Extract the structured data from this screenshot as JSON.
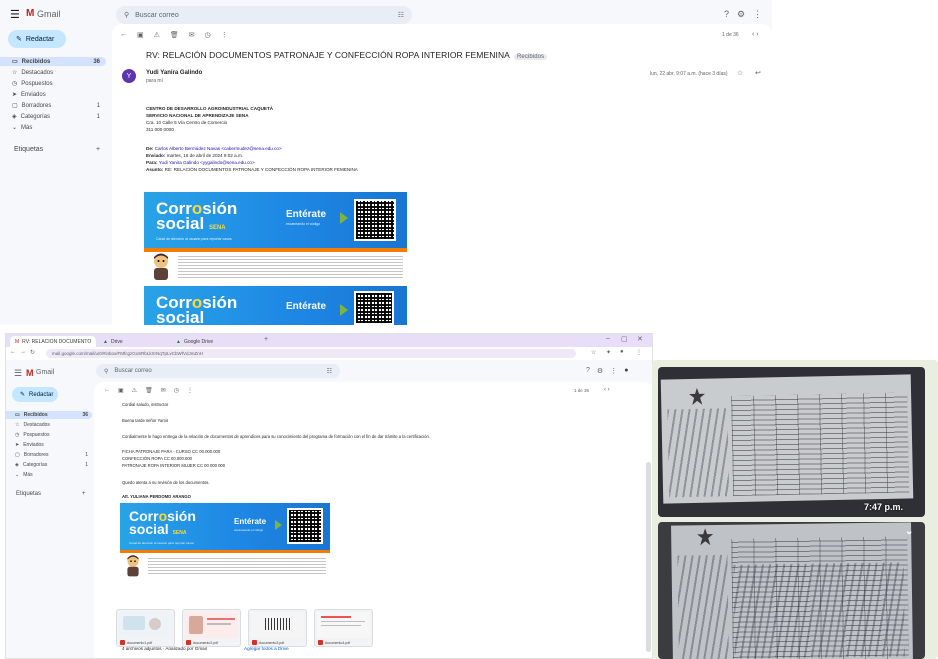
{
  "gmail": {
    "app_name": "Gmail",
    "compose_label": "Redactar",
    "search_placeholder": "Buscar correo",
    "nav": [
      {
        "label": "Recibidos",
        "count": "36"
      },
      {
        "label": "Destacados",
        "count": ""
      },
      {
        "label": "Pospuestos",
        "count": ""
      },
      {
        "label": "Enviados",
        "count": ""
      },
      {
        "label": "Borradores",
        "count": "1"
      },
      {
        "label": "Categorías",
        "count": "1"
      },
      {
        "label": "Más",
        "count": ""
      }
    ],
    "labels_heading": "Etiquetas"
  },
  "mail1": {
    "subject": "RV: RELACIÓN DOCUMENTOS PATRONAJE Y CONFECCIÓN ROPA INTERIOR FEMENINA",
    "subject_tag": "Recibidos",
    "sender": "Yudi Yanira Galindo",
    "to_me": "para mí",
    "date": "lun, 22 abr, 9:07 a.m. (hace 3 días)",
    "avatar_letter": "Y",
    "page_count": "1 de 36",
    "body_lines": [
      "CENTRO DE DESARROLLO AGROINDUSTRIAL CAQUETÁ",
      "SERVICIO NACIONAL DE APRENDIZAJE SENA",
      "Cra. 10 Calle 5 Vía Centro de Comercio",
      "311 000 0000"
    ],
    "meta_lines": [
      {
        "k": "De:",
        "v": "Carlos Alberto Bermúdez Navas <cabermudez@sena.edu.co>"
      },
      {
        "k": "Enviado:",
        "v": "martes, 16 de abril de 2024 9:02 a.m."
      },
      {
        "k": "Para:",
        "v": "Yudi Yanira Galindo <yygalindo@sena.edu.co>"
      },
      {
        "k": "Asunto:",
        "v": "RE: RELACIÓN DOCUMENTOS PATRONAJE Y CONFECCIÓN ROPA INTERIOR FEMENINA"
      }
    ]
  },
  "banner": {
    "brand_line1": "Corr",
    "brand_o": "o",
    "brand_line1b": "sión",
    "brand_line2": "social",
    "brand_small": "SENA",
    "subtext": "Canal de atención al usuario para reportar casos",
    "cta": "Entérate",
    "cta_sub": "escaneando el código"
  },
  "mail2": {
    "body_lines": [
      "Cordial saludo, instructor",
      "Buena tarde señor Yamir",
      "Cordialmente le hago entrega de la relación de documentos de aprendices para su conocimiento del programa de formación con el fin de dar trámite a la certificación.",
      "FICHA PATRONAJE PARA - CURSO          CC 00.000.000",
      "CONFECCIÓN ROPA                      CC 00.000.000",
      "PATRONAJE ROPA INTERIOR MUJER         CC 00 000 000",
      "Quedo atenta a su revisión de los documentos.",
      "Att. YULIANA PERDOMO ARANGO"
    ],
    "attachments_heading": "4 archivos adjuntos · Analizado por Gmail",
    "add_drive": "Agregar todos a Drive",
    "attachments": [
      {
        "name": "documento1.pdf"
      },
      {
        "name": "documento2.pdf"
      },
      {
        "name": "documento3.pdf"
      },
      {
        "name": "documento4.pdf"
      }
    ]
  },
  "browser": {
    "tabs": [
      {
        "label": "RV: RELACIÓN DOCUMENTOS PATRONAJE"
      },
      {
        "label": "Drive"
      },
      {
        "label": "Google Drive"
      }
    ],
    "url": "mail.google.com/mail/u/0/#inbox/FMfcgzGxSRbLkXrNqTpLvCbWfVdJmZnH"
  },
  "photos": {
    "time_label": "7:47 p.m."
  },
  "colors": {
    "compose_bg": "#c2e7ff",
    "active_nav": "#d3e3fd",
    "banner_blue": "#1e88e5",
    "banner_orange": "#f57c00",
    "tab_bar": "#e8def8"
  }
}
